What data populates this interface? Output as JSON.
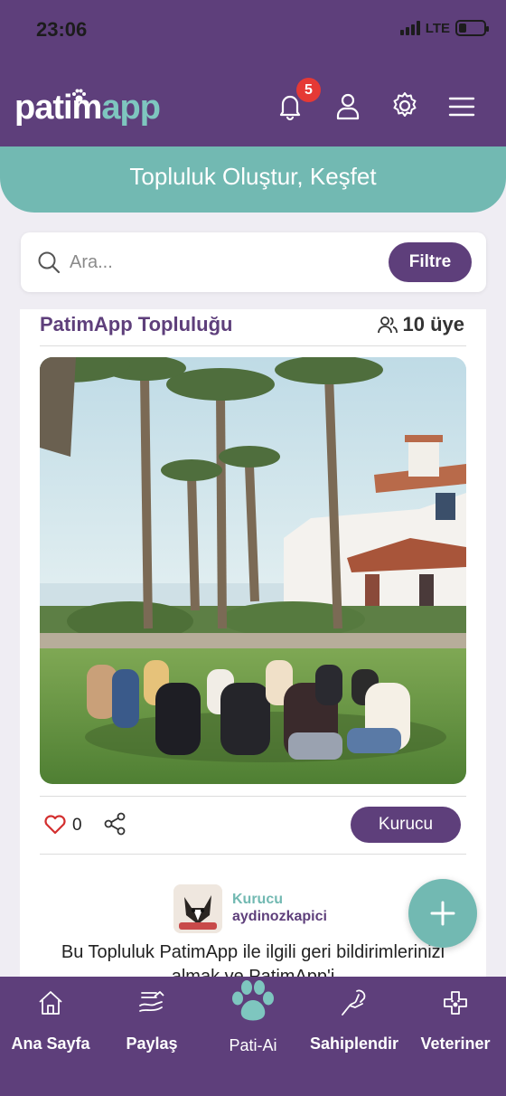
{
  "status_bar": {
    "time": "23:06",
    "network": "LTE",
    "battery_level": 0.3
  },
  "header": {
    "logo_part1": "patim",
    "logo_part2": "app",
    "notification_count": "5",
    "icons": [
      "bell-icon",
      "user-icon",
      "gear-icon",
      "menu-icon"
    ]
  },
  "banner": {
    "title": "Topluluk Oluştur, Keşfet"
  },
  "search": {
    "placeholder": "Ara...",
    "value": "",
    "filter_label": "Filtre"
  },
  "community": {
    "title": "PatimApp Topluluğu",
    "members": "10 üye",
    "likes": "0",
    "role_button": "Kurucu",
    "author_role": "Kurucu",
    "author_name": "aydinozkapici",
    "description": "Bu Topluluk PatimApp ile ilgili geri bildirimlerinizi almak ve PatimApp'i"
  },
  "bottom_nav": {
    "items": [
      {
        "label": "Ana Sayfa",
        "icon": "home-icon"
      },
      {
        "label": "Paylaş",
        "icon": "share-hands-icon"
      },
      {
        "label": "Pati-Ai",
        "icon": "paw-icon"
      },
      {
        "label": "Sahiplendir",
        "icon": "adopt-hand-icon"
      },
      {
        "label": "Veteriner",
        "icon": "vet-cross-icon"
      }
    ]
  },
  "colors": {
    "primary": "#5e3f7b",
    "accent": "#72b9b2",
    "badge": "#e53935"
  }
}
